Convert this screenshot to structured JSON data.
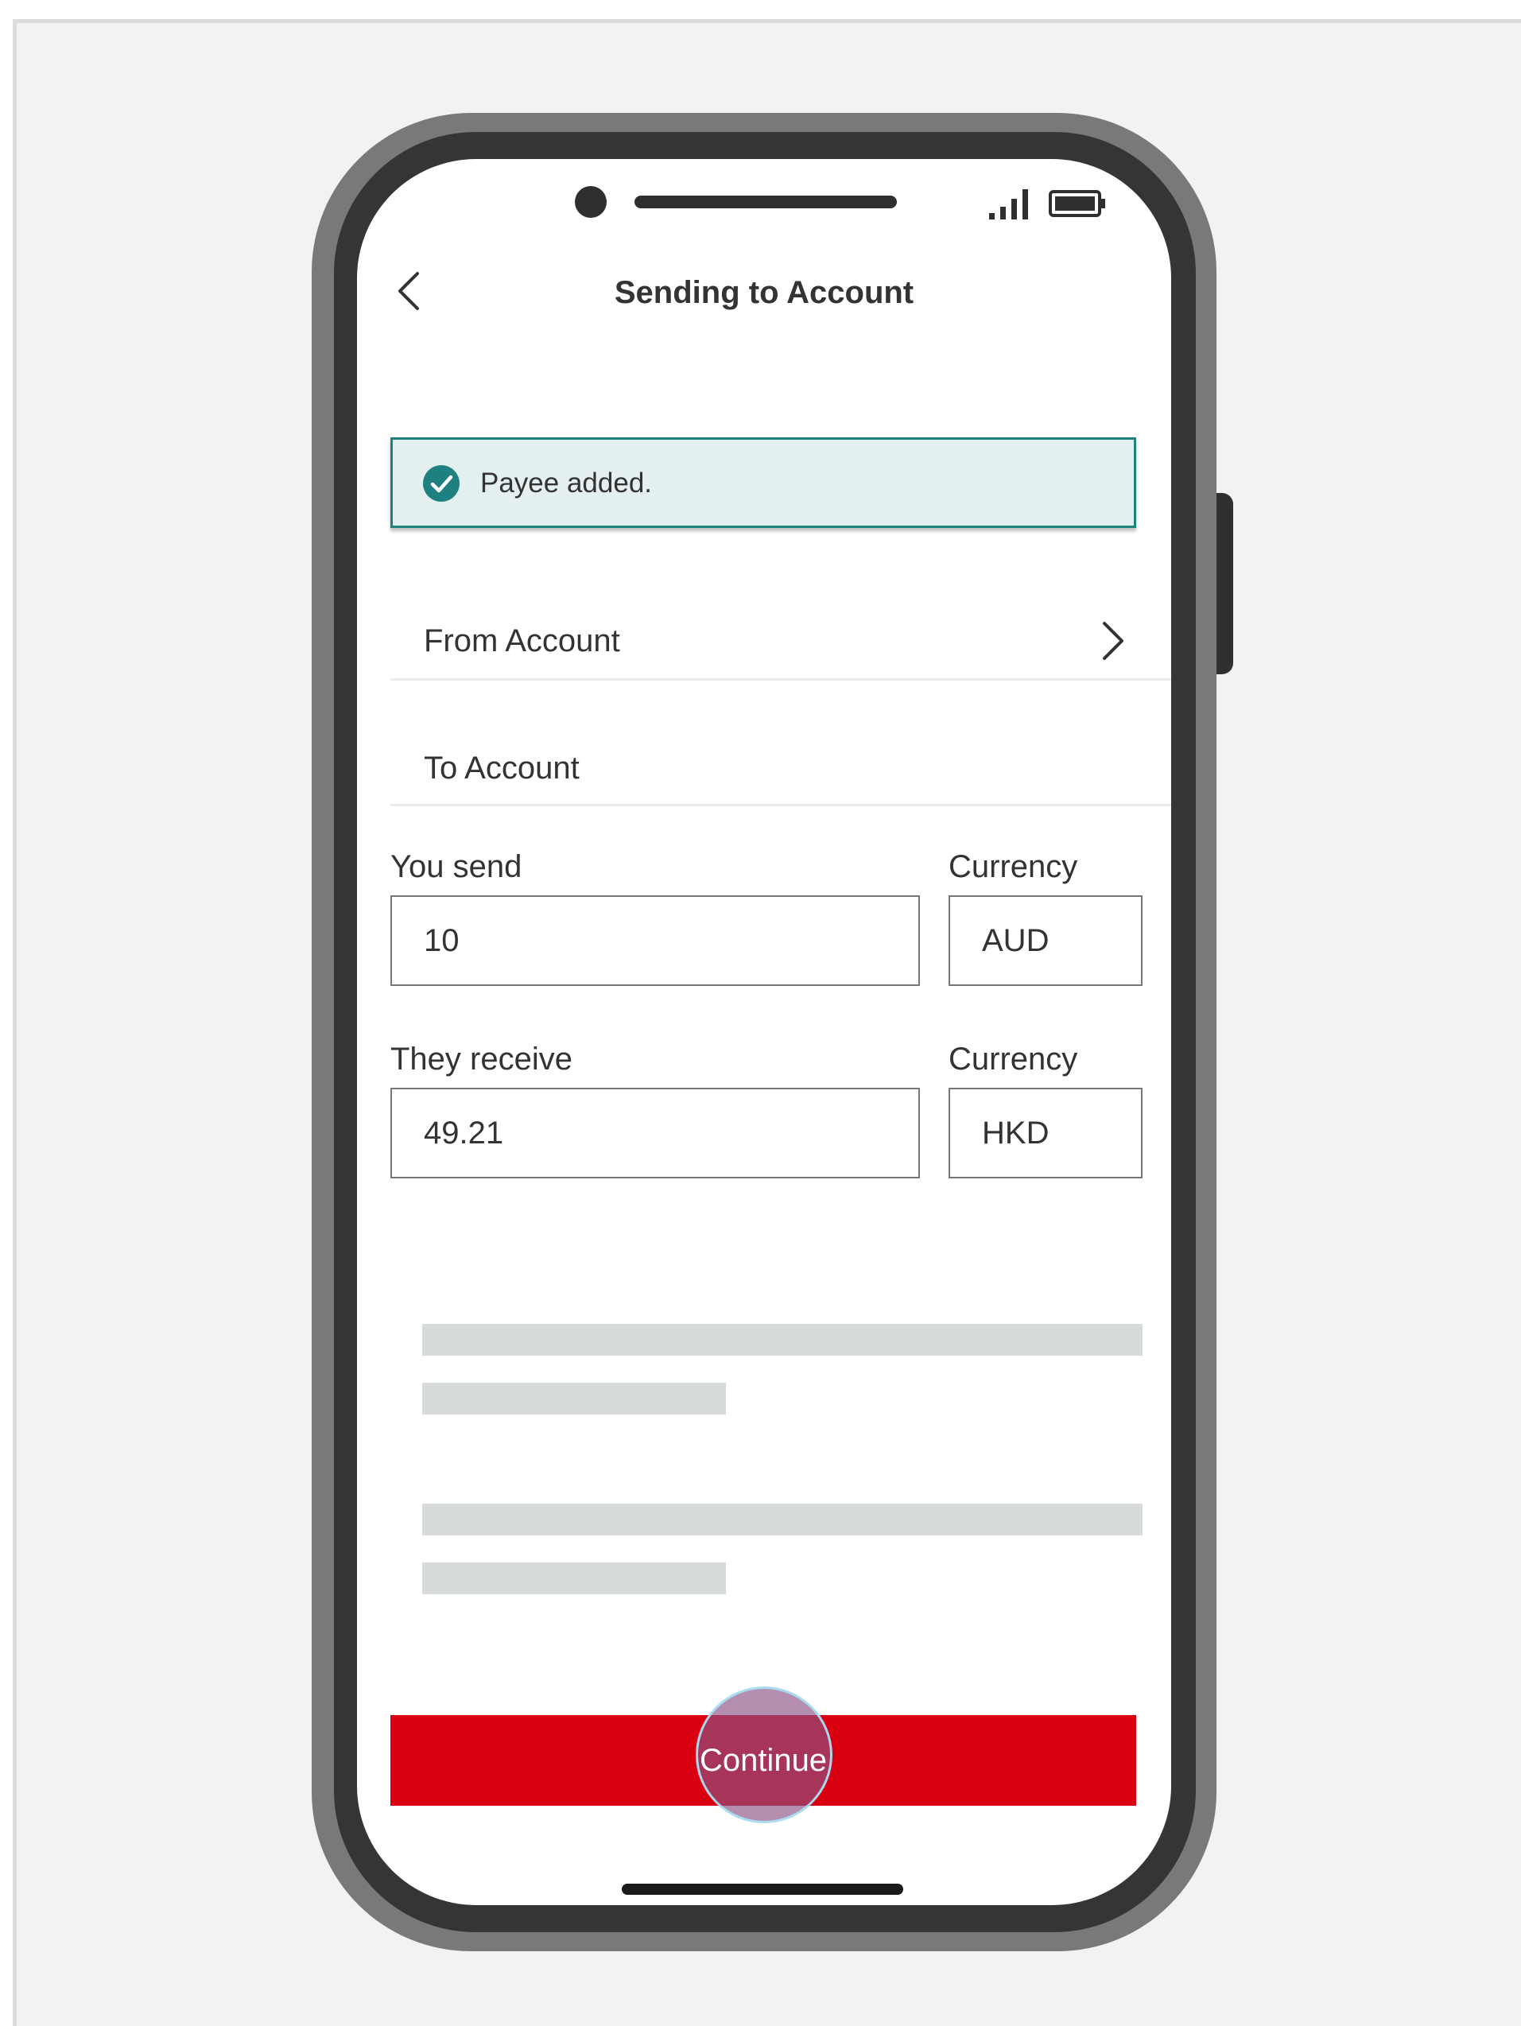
{
  "header": {
    "title": "Sending to Account",
    "back_icon": "chevron-left-icon"
  },
  "status_bar": {
    "signal_icon": "signal-icon",
    "battery_icon": "battery-icon"
  },
  "toast": {
    "icon": "check-circle-icon",
    "message": "Payee added.",
    "accent_color": "#1f8080",
    "background_color": "#e4f0f0"
  },
  "form": {
    "from_account": {
      "label": "From Account",
      "icon": "chevron-right-icon"
    },
    "to_account": {
      "label": "To Account"
    },
    "you_send": {
      "label": "You send",
      "value": "10"
    },
    "send_currency": {
      "label": "Currency",
      "value": "AUD"
    },
    "they_receive": {
      "label": "They receive",
      "value": "49.21"
    },
    "receive_currency": {
      "label": "Currency",
      "value": "HKD"
    }
  },
  "actions": {
    "continue_label": "Continue",
    "continue_color": "#db0011"
  }
}
